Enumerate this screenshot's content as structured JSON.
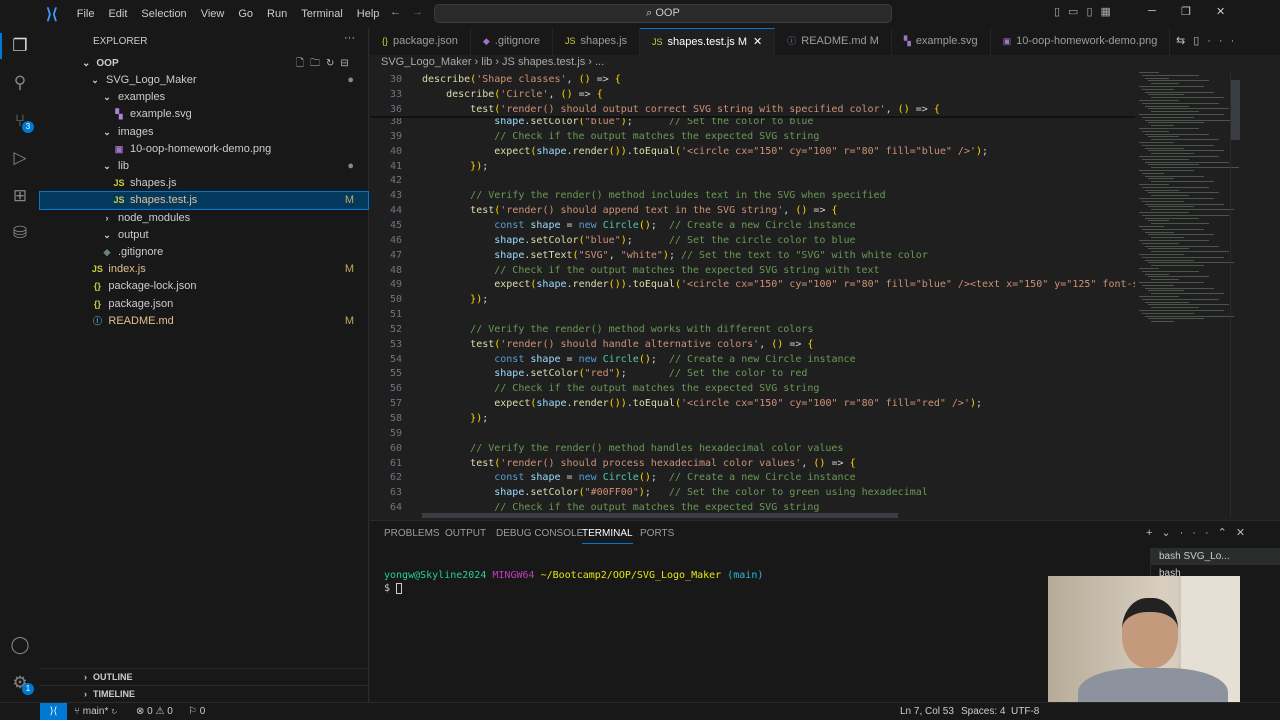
{
  "menu": [
    "File",
    "Edit",
    "Selection",
    "View",
    "Go",
    "Run",
    "Terminal",
    "Help"
  ],
  "search": "OOP",
  "explorer": {
    "title": "EXPLORER",
    "root": "OOP",
    "source_control_badge": "3",
    "accounts_badge": "1",
    "items": [
      {
        "label": "SVG_Logo_Maker",
        "icon": "chevron-down",
        "depth": 1,
        "dot": true
      },
      {
        "label": "examples",
        "icon": "chevron-down",
        "depth": 2
      },
      {
        "label": "example.svg",
        "icon": "svg",
        "depth": 3
      },
      {
        "label": "images",
        "icon": "chevron-down",
        "depth": 2
      },
      {
        "label": "10-oop-homework-demo.png",
        "icon": "image",
        "depth": 3
      },
      {
        "label": "lib",
        "icon": "chevron-down",
        "depth": 2,
        "dot": true
      },
      {
        "label": "shapes.js",
        "icon": "js",
        "depth": 3
      },
      {
        "label": "shapes.test.js",
        "icon": "js",
        "depth": 3,
        "badge": "M",
        "selected": true
      },
      {
        "label": "node_modules",
        "icon": "chevron-right",
        "depth": 2
      },
      {
        "label": "output",
        "icon": "chevron-down",
        "depth": 2
      },
      {
        "label": ".gitignore",
        "icon": "git",
        "depth": 2
      },
      {
        "label": "index.js",
        "icon": "js",
        "depth": 1.2,
        "badge": "M"
      },
      {
        "label": "package-lock.json",
        "icon": "json",
        "depth": 1.2
      },
      {
        "label": "package.json",
        "icon": "json",
        "depth": 1.2
      },
      {
        "label": "README.md",
        "icon": "info",
        "depth": 1.2,
        "badge": "M"
      }
    ],
    "outline": "OUTLINE",
    "timeline": "TIMELINE"
  },
  "tabs": [
    {
      "label": "package.json",
      "icon": "{}"
    },
    {
      "label": ".gitignore",
      "icon": "◆"
    },
    {
      "label": "shapes.js",
      "icon": "JS"
    },
    {
      "label": "shapes.test.js M",
      "icon": "JS",
      "active": true
    },
    {
      "label": "README.md M",
      "icon": "ⓘ"
    },
    {
      "label": "example.svg",
      "icon": "▚"
    },
    {
      "label": "10-oop-homework-demo.png",
      "icon": "▣"
    }
  ],
  "breadcrumb": "SVG_Logo_Maker › lib › JS shapes.test.js › ...",
  "code": {
    "sticky": [
      {
        "n": "30",
        "t": "describe('Shape classes', () => {"
      },
      {
        "n": "33",
        "t": "    describe('Circle', () => {"
      },
      {
        "n": "36",
        "t": "        test('render() should output correct SVG string with specified color', () => {"
      }
    ],
    "lines": [
      {
        "n": "38",
        "t": "            shape.setColor(\"blue\");      // Set the color to blue"
      },
      {
        "n": "39",
        "t": "            // Check if the output matches the expected SVG string"
      },
      {
        "n": "40",
        "t": "            expect(shape.render()).toEqual('<circle cx=\"150\" cy=\"100\" r=\"80\" fill=\"blue\" />');"
      },
      {
        "n": "41",
        "t": "        });"
      },
      {
        "n": "42",
        "t": ""
      },
      {
        "n": "43",
        "t": "        // Verify the render() method includes text in the SVG when specified"
      },
      {
        "n": "44",
        "t": "        test('render() should append text in the SVG string', () => {"
      },
      {
        "n": "45",
        "t": "            const shape = new Circle();  // Create a new Circle instance"
      },
      {
        "n": "46",
        "t": "            shape.setColor(\"blue\");      // Set the circle color to blue"
      },
      {
        "n": "47",
        "t": "            shape.setText(\"SVG\", \"white\"); // Set the text to \"SVG\" with white color"
      },
      {
        "n": "48",
        "t": "            // Check if the output matches the expected SVG string with text"
      },
      {
        "n": "49",
        "t": "            expect(shape.render()).toEqual('<circle cx=\"150\" cy=\"100\" r=\"80\" fill=\"blue\" /><text x=\"150\" y=\"125\" font-s"
      },
      {
        "n": "50",
        "t": "        });"
      },
      {
        "n": "51",
        "t": ""
      },
      {
        "n": "52",
        "t": "        // Verify the render() method works with different colors"
      },
      {
        "n": "53",
        "t": "        test('render() should handle alternative colors', () => {"
      },
      {
        "n": "54",
        "t": "            const shape = new Circle();  // Create a new Circle instance"
      },
      {
        "n": "55",
        "t": "            shape.setColor(\"red\");       // Set the color to red"
      },
      {
        "n": "56",
        "t": "            // Check if the output matches the expected SVG string"
      },
      {
        "n": "57",
        "t": "            expect(shape.render()).toEqual('<circle cx=\"150\" cy=\"100\" r=\"80\" fill=\"red\" />');"
      },
      {
        "n": "58",
        "t": "        });"
      },
      {
        "n": "59",
        "t": ""
      },
      {
        "n": "60",
        "t": "        // Verify the render() method handles hexadecimal color values"
      },
      {
        "n": "61",
        "t": "        test('render() should process hexadecimal color values', () => {"
      },
      {
        "n": "62",
        "t": "            const shape = new Circle();  // Create a new Circle instance"
      },
      {
        "n": "63",
        "t": "            shape.setColor(\"#00FF00\");   // Set the color to green using hexadecimal"
      },
      {
        "n": "64",
        "t": "            // Check if the output matches the expected SVG string"
      }
    ]
  },
  "panel": {
    "tabs": [
      "PROBLEMS",
      "OUTPUT",
      "DEBUG CONSOLE",
      "TERMINAL",
      "PORTS"
    ],
    "active": "TERMINAL",
    "prompt_user": "yongw@Skyline2024",
    "prompt_env": "MINGW64",
    "prompt_path": "~/Bootcamp2/OOP/SVG_Logo_Maker",
    "prompt_branch": "(main)",
    "prompt_symbol": "$",
    "terminals": [
      "bash SVG_Lo...",
      "bash"
    ]
  },
  "status": {
    "branch": "main*",
    "errors": "0",
    "warnings": "0",
    "ports": "0",
    "position": "Ln 7, Col 53",
    "spaces": "Spaces: 4",
    "encoding": "UTF-8"
  }
}
